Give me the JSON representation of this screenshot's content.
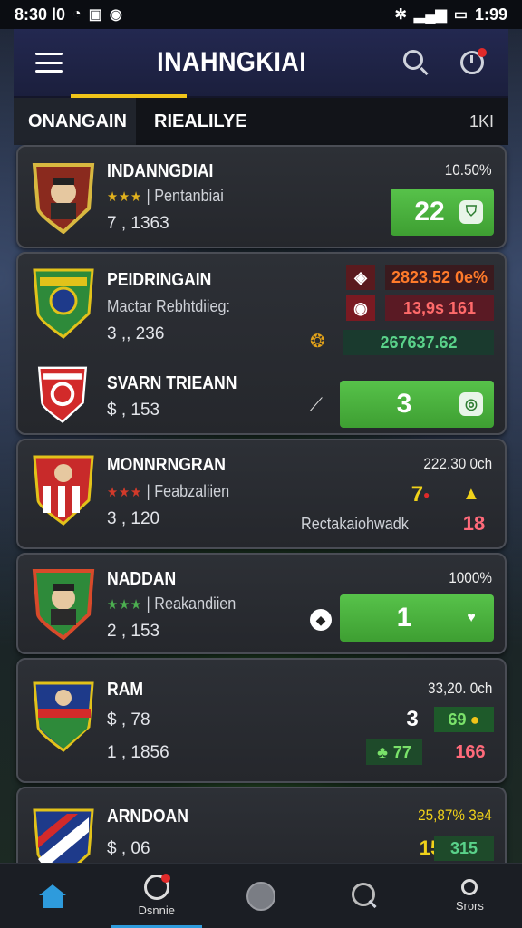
{
  "status_bar": {
    "time_left": "8:30 l0",
    "time_right": "1:99",
    "wifi_icon": "wifi-icon",
    "signal_icon": "signal-icon",
    "battery_icon": "battery-icon"
  },
  "header": {
    "title": "INAHNGKIAI",
    "menu_icon": "hamburger-icon",
    "search_icon": "search-icon",
    "timer_icon": "timer-icon"
  },
  "tabs": {
    "items": [
      {
        "label": "ONANGAIN"
      },
      {
        "label": "RIEALILYE"
      }
    ],
    "count": "1KI"
  },
  "cards": [
    {
      "teams": [
        {
          "name": "INDANNGDIAI",
          "stars": "★★★",
          "sub": "Pentanbiai",
          "value": "7 , 1363",
          "crest_colors": [
            "#d8b840",
            "#8a2a1e"
          ]
        }
      ],
      "pct": "10.50%",
      "bet": {
        "value": "22",
        "icon": "shield-icon"
      }
    },
    {
      "teams": [
        {
          "name": "PEIDRINGAIN",
          "sub": "Mactar Rebhtdiieg:",
          "value": "3 ,, 236",
          "crest_colors": [
            "#2e8a3a",
            "#e2c21a"
          ]
        },
        {
          "name": "SVARN TRIEANN",
          "value": "$ , 153",
          "crest_colors": [
            "#d22a2a",
            "#ffffff"
          ]
        }
      ],
      "odds": [
        "2823.52 0e%",
        "13,9s 161",
        "267637.62"
      ],
      "bet": {
        "value": "3",
        "icon": "coin-icon"
      }
    },
    {
      "teams": [
        {
          "name": "MONNRNGRAN",
          "stars": "★★★",
          "sub": "Feabzaliien",
          "value": "3 , 120",
          "crest_colors": [
            "#c82a2a",
            "#ffffff"
          ]
        }
      ],
      "pct": "222.30 0ch",
      "score": "7",
      "note": "Rectakaiohwadk",
      "note_value": "18"
    },
    {
      "teams": [
        {
          "name": "NADDAN",
          "stars": "★★★",
          "sub": "Reakandiien",
          "value": "2 , 153",
          "crest_colors": [
            "#d84a2a",
            "#2e8a3a"
          ]
        }
      ],
      "pct": "1000%",
      "bet": {
        "value": "1",
        "icon": "heart-icon"
      }
    },
    {
      "teams": [
        {
          "name": "RAM",
          "value": "$ , 78",
          "value2": "1 , 1856",
          "crest_colors": [
            "#1e3a8a",
            "#2e8a3a"
          ]
        }
      ],
      "pct": "33,20. 0ch",
      "score": "3",
      "odds_a": "69",
      "odds_b": "77",
      "odds_c": "166"
    },
    {
      "teams": [
        {
          "name": "ARNDOAN",
          "value": "$ , 06",
          "crest_colors": [
            "#1e3a8a",
            "#d22a2a"
          ]
        }
      ],
      "pct": "25,87% 3e4",
      "score": "15",
      "odds_a": "315"
    }
  ],
  "bottom_nav": [
    {
      "label": "",
      "icon": "home-icon"
    },
    {
      "label": "Dsnnie",
      "icon": "timer-icon"
    },
    {
      "label": "",
      "icon": "ball-icon"
    },
    {
      "label": "",
      "icon": "search-icon"
    },
    {
      "label": "Srors",
      "icon": "profile-icon"
    }
  ],
  "colors": {
    "accent_green": "#4caf50",
    "accent_yellow": "#f0c419",
    "accent_blue": "#2e9bdc",
    "alert_red": "#e02a2a"
  }
}
